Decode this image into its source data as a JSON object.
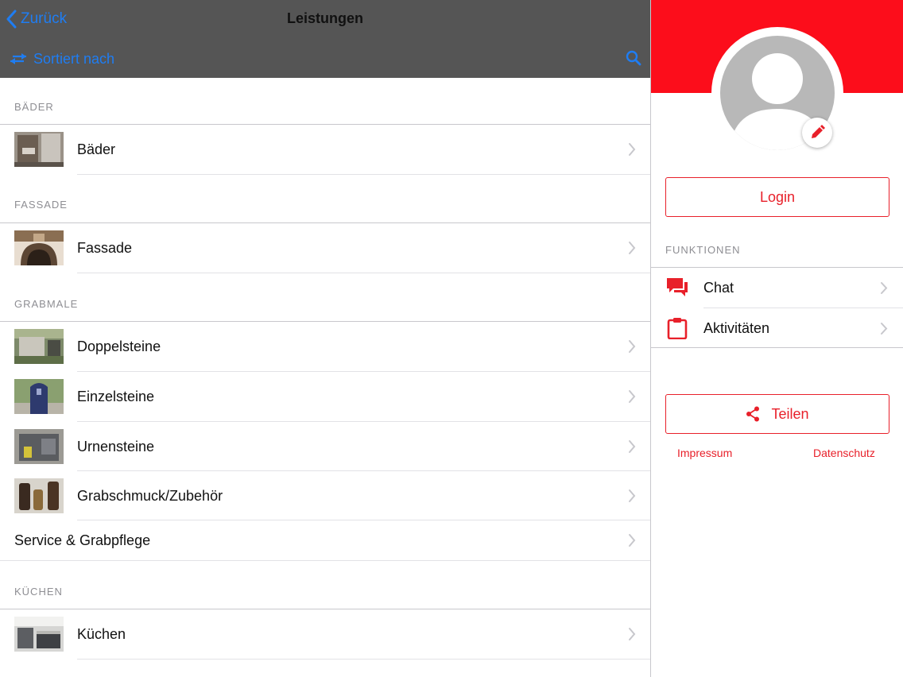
{
  "nav": {
    "back_label": "Zurück",
    "title": "Leistungen",
    "sort_label": "Sortiert nach"
  },
  "sections": [
    {
      "header": "BÄDER",
      "items": [
        {
          "label": "Bäder",
          "has_image": true
        }
      ]
    },
    {
      "header": "FASSADE",
      "items": [
        {
          "label": "Fassade",
          "has_image": true
        }
      ]
    },
    {
      "header": "GRABMALE",
      "items": [
        {
          "label": "Doppelsteine",
          "has_image": true
        },
        {
          "label": "Einzelsteine",
          "has_image": true
        },
        {
          "label": "Urnensteine",
          "has_image": true
        },
        {
          "label": "Grabschmuck/Zubehör",
          "has_image": true
        },
        {
          "label": "Service & Grabpflege",
          "has_image": false
        }
      ]
    },
    {
      "header": "KÜCHEN",
      "items": [
        {
          "label": "Küchen",
          "has_image": true
        }
      ]
    }
  ],
  "sidebar": {
    "login_label": "Login",
    "functions_header": "FUNKTIONEN",
    "functions": [
      {
        "label": "Chat",
        "icon": "chat-icon"
      },
      {
        "label": "Aktivitäten",
        "icon": "clipboard-icon"
      }
    ],
    "share_label": "Teilen",
    "impressum_label": "Impressum",
    "datenschutz_label": "Datenschutz"
  },
  "colors": {
    "accent_red": "#fc0d1b",
    "nav_blue": "#1f7df2",
    "navbar_bg": "#555555"
  }
}
